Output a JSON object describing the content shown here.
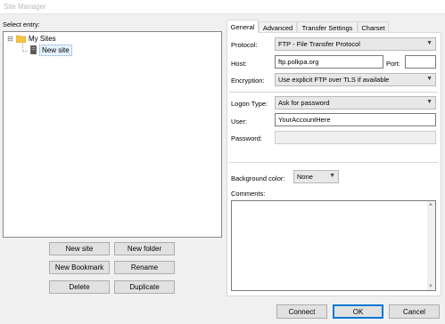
{
  "window": {
    "title": "Site Manager"
  },
  "left": {
    "select_entry_label": "Select entry:",
    "tree": {
      "root_label": "My Sites",
      "root_expander": "⊟",
      "child_label": "New site"
    },
    "buttons": {
      "new_site": "New site",
      "new_folder": "New folder",
      "new_bookmark": "New Bookmark",
      "rename": "Rename",
      "delete": "Delete",
      "duplicate": "Duplicate"
    }
  },
  "tabs": [
    "General",
    "Advanced",
    "Transfer Settings",
    "Charset"
  ],
  "general": {
    "protocol_label": "Protocol:",
    "protocol_value": "FTP - File Transfer Protocol",
    "host_label": "Host:",
    "host_value": "ftp.polkpa.org",
    "port_label": "Port:",
    "port_value": "",
    "encryption_label": "Encryption:",
    "encryption_value": "Use explicit FTP over TLS if available",
    "logon_type_label": "Logon Type:",
    "logon_type_value": "Ask for password",
    "user_label": "User:",
    "user_value": "YourAccountHere",
    "password_label": "Password:",
    "password_value": "",
    "bg_color_label": "Background color:",
    "bg_color_value": "None",
    "comments_label": "Comments:"
  },
  "footer": {
    "connect": "Connect",
    "ok": "OK",
    "cancel": "Cancel"
  },
  "icons": {
    "dropdown": "chevron-down-icon",
    "folder": "folder-icon",
    "site": "server-icon"
  },
  "colors": {
    "accent_border": "#0078d7",
    "folder_yellow": "#f5c542",
    "selection": "#e5f3ff"
  }
}
